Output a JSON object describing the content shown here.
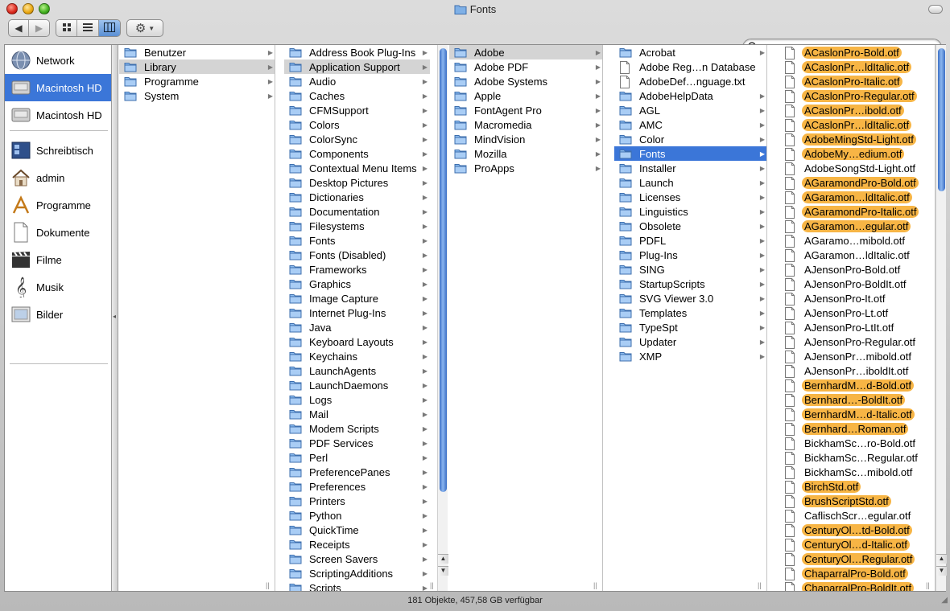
{
  "window": {
    "title": "Fonts",
    "status": "181 Objekte, 457,58 GB verfügbar"
  },
  "colors": {
    "selection_blue": "#3b76d8",
    "label_orange": "#f7b545",
    "selection_gray": "#d4d4d4"
  },
  "toolbar": {
    "back_icon": "arrow-left-icon",
    "forward_icon": "arrow-right-icon",
    "views": [
      "icon-view-icon",
      "list-view-icon",
      "column-view-icon"
    ],
    "active_view": "column-view-icon",
    "action_icon": "gear-icon",
    "search_placeholder": ""
  },
  "sidebar": {
    "items": [
      {
        "label": "Network",
        "icon": "globe-icon",
        "selected": false
      },
      {
        "label": "Macintosh HD",
        "icon": "disk-icon",
        "selected": true
      },
      {
        "label": "Macintosh HD",
        "icon": "disk-icon",
        "selected": false
      },
      {
        "label": "Schreibtisch",
        "icon": "desktop-icon",
        "selected": false
      },
      {
        "label": "admin",
        "icon": "home-icon",
        "selected": false
      },
      {
        "label": "Programme",
        "icon": "apps-icon",
        "selected": false
      },
      {
        "label": "Dokumente",
        "icon": "document-icon",
        "selected": false
      },
      {
        "label": "Filme",
        "icon": "movie-icon",
        "selected": false
      },
      {
        "label": "Musik",
        "icon": "music-icon",
        "selected": false
      },
      {
        "label": "Bilder",
        "icon": "pictures-icon",
        "selected": false
      }
    ]
  },
  "columns": [
    {
      "items": [
        {
          "label": "Benutzer",
          "kind": "folder",
          "arrow": true
        },
        {
          "label": "Library",
          "kind": "folder",
          "arrow": true,
          "selected": "gray"
        },
        {
          "label": "Programme",
          "kind": "folder",
          "arrow": true
        },
        {
          "label": "System",
          "kind": "folder",
          "arrow": true
        }
      ]
    },
    {
      "items": [
        {
          "label": "Address Book Plug-Ins",
          "kind": "folder",
          "arrow": true
        },
        {
          "label": "Application Support",
          "kind": "folder",
          "arrow": true,
          "selected": "gray"
        },
        {
          "label": "Audio",
          "kind": "folder",
          "arrow": true
        },
        {
          "label": "Caches",
          "kind": "folder",
          "arrow": true
        },
        {
          "label": "CFMSupport",
          "kind": "folder",
          "arrow": true
        },
        {
          "label": "Colors",
          "kind": "folder",
          "arrow": true
        },
        {
          "label": "ColorSync",
          "kind": "folder",
          "arrow": true
        },
        {
          "label": "Components",
          "kind": "folder",
          "arrow": true
        },
        {
          "label": "Contextual Menu Items",
          "kind": "folder",
          "arrow": true
        },
        {
          "label": "Desktop Pictures",
          "kind": "folder",
          "arrow": true
        },
        {
          "label": "Dictionaries",
          "kind": "folder",
          "arrow": true
        },
        {
          "label": "Documentation",
          "kind": "folder",
          "arrow": true
        },
        {
          "label": "Filesystems",
          "kind": "folder",
          "arrow": true
        },
        {
          "label": "Fonts",
          "kind": "folder",
          "arrow": true
        },
        {
          "label": "Fonts (Disabled)",
          "kind": "folder",
          "arrow": true
        },
        {
          "label": "Frameworks",
          "kind": "folder",
          "arrow": true
        },
        {
          "label": "Graphics",
          "kind": "folder",
          "arrow": true
        },
        {
          "label": "Image Capture",
          "kind": "folder",
          "arrow": true
        },
        {
          "label": "Internet Plug-Ins",
          "kind": "folder",
          "arrow": true
        },
        {
          "label": "Java",
          "kind": "folder",
          "arrow": true
        },
        {
          "label": "Keyboard Layouts",
          "kind": "folder",
          "arrow": true
        },
        {
          "label": "Keychains",
          "kind": "folder",
          "arrow": true
        },
        {
          "label": "LaunchAgents",
          "kind": "folder",
          "arrow": true
        },
        {
          "label": "LaunchDaemons",
          "kind": "folder",
          "arrow": true
        },
        {
          "label": "Logs",
          "kind": "folder",
          "arrow": true
        },
        {
          "label": "Mail",
          "kind": "folder",
          "arrow": true
        },
        {
          "label": "Modem Scripts",
          "kind": "folder",
          "arrow": true
        },
        {
          "label": "PDF Services",
          "kind": "folder",
          "arrow": true
        },
        {
          "label": "Perl",
          "kind": "folder",
          "arrow": true
        },
        {
          "label": "PreferencePanes",
          "kind": "folder",
          "arrow": true
        },
        {
          "label": "Preferences",
          "kind": "folder",
          "arrow": true
        },
        {
          "label": "Printers",
          "kind": "folder",
          "arrow": true
        },
        {
          "label": "Python",
          "kind": "folder",
          "arrow": true
        },
        {
          "label": "QuickTime",
          "kind": "folder",
          "arrow": true
        },
        {
          "label": "Receipts",
          "kind": "folder",
          "arrow": true
        },
        {
          "label": "Screen Savers",
          "kind": "folder",
          "arrow": true
        },
        {
          "label": "ScriptingAdditions",
          "kind": "folder",
          "arrow": true
        },
        {
          "label": "Scripts",
          "kind": "folder",
          "arrow": true
        }
      ]
    },
    {
      "items": [
        {
          "label": "Adobe",
          "kind": "folder",
          "arrow": true,
          "selected": "gray"
        },
        {
          "label": "Adobe PDF",
          "kind": "folder",
          "arrow": true
        },
        {
          "label": "Adobe Systems",
          "kind": "folder",
          "arrow": true
        },
        {
          "label": "Apple",
          "kind": "folder",
          "arrow": true
        },
        {
          "label": "FontAgent Pro",
          "kind": "folder",
          "arrow": true
        },
        {
          "label": "Macromedia",
          "kind": "folder",
          "arrow": true
        },
        {
          "label": "MindVision",
          "kind": "folder",
          "arrow": true
        },
        {
          "label": "Mozilla",
          "kind": "folder",
          "arrow": true
        },
        {
          "label": "ProApps",
          "kind": "folder",
          "arrow": true
        }
      ]
    },
    {
      "items": [
        {
          "label": "Acrobat",
          "kind": "folder",
          "arrow": true
        },
        {
          "label": "Adobe Reg…n Database",
          "kind": "file",
          "arrow": false
        },
        {
          "label": "AdobeDef…nguage.txt",
          "kind": "file",
          "arrow": false
        },
        {
          "label": "AdobeHelpData",
          "kind": "folder",
          "arrow": true
        },
        {
          "label": "AGL",
          "kind": "folder",
          "arrow": true
        },
        {
          "label": "AMC",
          "kind": "folder",
          "arrow": true
        },
        {
          "label": "Color",
          "kind": "folder",
          "arrow": true
        },
        {
          "label": "Fonts",
          "kind": "folder",
          "arrow": true,
          "selected": "blue"
        },
        {
          "label": "Installer",
          "kind": "folder",
          "arrow": true
        },
        {
          "label": "Launch",
          "kind": "folder",
          "arrow": true
        },
        {
          "label": "Licenses",
          "kind": "folder",
          "arrow": true
        },
        {
          "label": "Linguistics",
          "kind": "folder",
          "arrow": true
        },
        {
          "label": "Obsolete",
          "kind": "folder",
          "arrow": true
        },
        {
          "label": "PDFL",
          "kind": "folder",
          "arrow": true
        },
        {
          "label": "Plug-Ins",
          "kind": "folder",
          "arrow": true
        },
        {
          "label": "SING",
          "kind": "folder",
          "arrow": true
        },
        {
          "label": "StartupScripts",
          "kind": "folder",
          "arrow": true
        },
        {
          "label": "SVG Viewer 3.0",
          "kind": "folder",
          "arrow": true
        },
        {
          "label": "Templates",
          "kind": "folder",
          "arrow": true
        },
        {
          "label": "TypeSpt",
          "kind": "folder",
          "arrow": true
        },
        {
          "label": "Updater",
          "kind": "folder",
          "arrow": true
        },
        {
          "label": "XMP",
          "kind": "folder",
          "arrow": true
        }
      ]
    },
    {
      "items": [
        {
          "label": "ACaslonPro-Bold.otf",
          "kind": "file",
          "orange": true
        },
        {
          "label": "ACaslonPr…ldItalic.otf",
          "kind": "file",
          "orange": true
        },
        {
          "label": "ACaslonPro-Italic.otf",
          "kind": "file",
          "orange": true
        },
        {
          "label": "ACaslonPro-Regular.otf",
          "kind": "file",
          "orange": true
        },
        {
          "label": "ACaslonPr…ibold.otf",
          "kind": "file",
          "orange": true
        },
        {
          "label": "ACaslonPr…ldItalic.otf",
          "kind": "file",
          "orange": true
        },
        {
          "label": "AdobeMingStd-Light.otf",
          "kind": "file",
          "orange": true
        },
        {
          "label": "AdobeMy…edium.otf",
          "kind": "file",
          "orange": true
        },
        {
          "label": "AdobeSongStd-Light.otf",
          "kind": "file",
          "orange": false
        },
        {
          "label": "AGaramondPro-Bold.otf",
          "kind": "file",
          "orange": true
        },
        {
          "label": "AGaramon…ldItalic.otf",
          "kind": "file",
          "orange": true
        },
        {
          "label": "AGaramondPro-Italic.otf",
          "kind": "file",
          "orange": true
        },
        {
          "label": "AGaramon…egular.otf",
          "kind": "file",
          "orange": true
        },
        {
          "label": "AGaramo…mibold.otf",
          "kind": "file",
          "orange": false
        },
        {
          "label": "AGaramon…ldItalic.otf",
          "kind": "file",
          "orange": false
        },
        {
          "label": "AJensonPro-Bold.otf",
          "kind": "file",
          "orange": false
        },
        {
          "label": "AJensonPro-BoldIt.otf",
          "kind": "file",
          "orange": false
        },
        {
          "label": "AJensonPro-It.otf",
          "kind": "file",
          "orange": false
        },
        {
          "label": "AJensonPro-Lt.otf",
          "kind": "file",
          "orange": false
        },
        {
          "label": "AJensonPro-LtIt.otf",
          "kind": "file",
          "orange": false
        },
        {
          "label": "AJensonPro-Regular.otf",
          "kind": "file",
          "orange": false
        },
        {
          "label": "AJensonPr…mibold.otf",
          "kind": "file",
          "orange": false
        },
        {
          "label": "AJensonPr…iboldIt.otf",
          "kind": "file",
          "orange": false
        },
        {
          "label": "BernhardM…d-Bold.otf",
          "kind": "file",
          "orange": true
        },
        {
          "label": "Bernhard…-BoldIt.otf",
          "kind": "file",
          "orange": true
        },
        {
          "label": "BernhardM…d-Italic.otf",
          "kind": "file",
          "orange": true
        },
        {
          "label": "Bernhard…Roman.otf",
          "kind": "file",
          "orange": true
        },
        {
          "label": "BickhamSc…ro-Bold.otf",
          "kind": "file",
          "orange": false
        },
        {
          "label": "BickhamSc…Regular.otf",
          "kind": "file",
          "orange": false
        },
        {
          "label": "BickhamSc…mibold.otf",
          "kind": "file",
          "orange": false
        },
        {
          "label": "BirchStd.otf",
          "kind": "file",
          "orange": true
        },
        {
          "label": "BrushScriptStd.otf",
          "kind": "file",
          "orange": true
        },
        {
          "label": "CaflischScr…egular.otf",
          "kind": "file",
          "orange": false
        },
        {
          "label": "CenturyOl…td-Bold.otf",
          "kind": "file",
          "orange": true
        },
        {
          "label": "CenturyOl…d-Italic.otf",
          "kind": "file",
          "orange": true
        },
        {
          "label": "CenturyOl…Regular.otf",
          "kind": "file",
          "orange": true
        },
        {
          "label": "ChaparralPro-Bold.otf",
          "kind": "file",
          "orange": true
        },
        {
          "label": "ChaparralPro-BoldIt.otf",
          "kind": "file",
          "orange": true
        }
      ]
    }
  ]
}
